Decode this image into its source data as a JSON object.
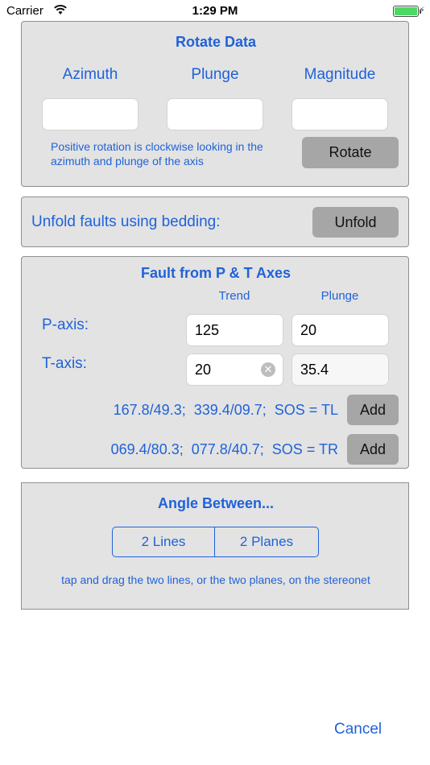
{
  "status": {
    "carrier": "Carrier",
    "time": "1:29 PM"
  },
  "rotate": {
    "title": "Rotate Data",
    "col1": "Azimuth",
    "col2": "Plunge",
    "col3": "Magnitude",
    "azimuth_value": "",
    "plunge_value": "",
    "magnitude_value": "",
    "note_line1": "Positive rotation is clockwise looking in the",
    "note_line2": "azimuth and plunge of the axis",
    "button": "Rotate"
  },
  "unfold": {
    "label": "Unfold faults using bedding:",
    "button": "Unfold"
  },
  "fault": {
    "title": "Fault from P & T Axes",
    "trend_header": "Trend",
    "plunge_header": "Plunge",
    "p_label": "P-axis:",
    "t_label": "T-axis:",
    "p_trend": "125",
    "p_plunge": "20",
    "t_trend": "20",
    "t_plunge": "35.4",
    "result1": "167.8/49.3;  339.4/09.7;  SOS = TL",
    "result2": "069.4/80.3;  077.8/40.7;  SOS = TR",
    "add_label": "Add"
  },
  "angle": {
    "title": "Angle Between...",
    "seg_lines": "2 Lines",
    "seg_planes": "2 Planes",
    "hint": "tap and drag the two lines, or the two planes, on the stereonet"
  },
  "footer": {
    "cancel": "Cancel"
  }
}
